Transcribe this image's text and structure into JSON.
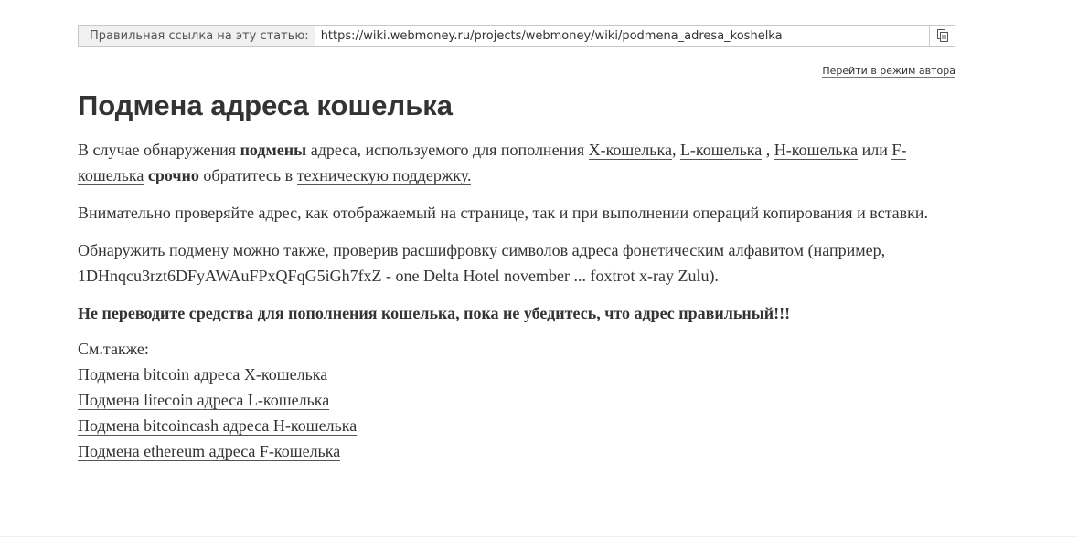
{
  "linkbar": {
    "label": "Правильная ссылка на эту статью:",
    "url": "https://wiki.webmoney.ru/projects/webmoney/wiki/podmena_adresa_koshelka"
  },
  "author_mode_link": "Перейти в режим автора",
  "title": "Подмена адреса кошелька",
  "p1": {
    "t1": "В случае обнаружения ",
    "b1": "подмены",
    "t2": " адреса, используемого для пополнения ",
    "link_x": "X-кошелька",
    "t3": ", ",
    "link_l": "L-кошелька",
    "t4": " , ",
    "link_h": "H-кошелька",
    "t5": " или ",
    "link_f": "F-кошелька",
    "t6": " ",
    "b2": "срочно",
    "t7": " обратитесь в ",
    "link_support": "техническую поддержку."
  },
  "p2": "Внимательно проверяйте адрес, как отображаемый на странице, так и при выполнении операций копирования и вставки.",
  "p3": "Обнаружить подмену можно также, проверив расшифровку символов адреса фонетическим алфавитом (например, 1DHnqcu3rzt6DFyAWAuFPxQFqG5iGh7fxZ - one Delta Hotel november ... foxtrot x-ray Zulu).",
  "p4": "Не переводите средства для пополнения кошелька, пока не убедитесь, что адрес правильный!!!",
  "see_also": {
    "label": "См.также:",
    "links": [
      "Подмена bitcoin адреса X-кошелька",
      "Подмена litecoin адреса L-кошелька",
      "Подмена bitcoincash адреса H-кошелька",
      "Подмена ethereum адреса F-кошелька"
    ]
  },
  "icons": {
    "copy": "copy-icon"
  }
}
